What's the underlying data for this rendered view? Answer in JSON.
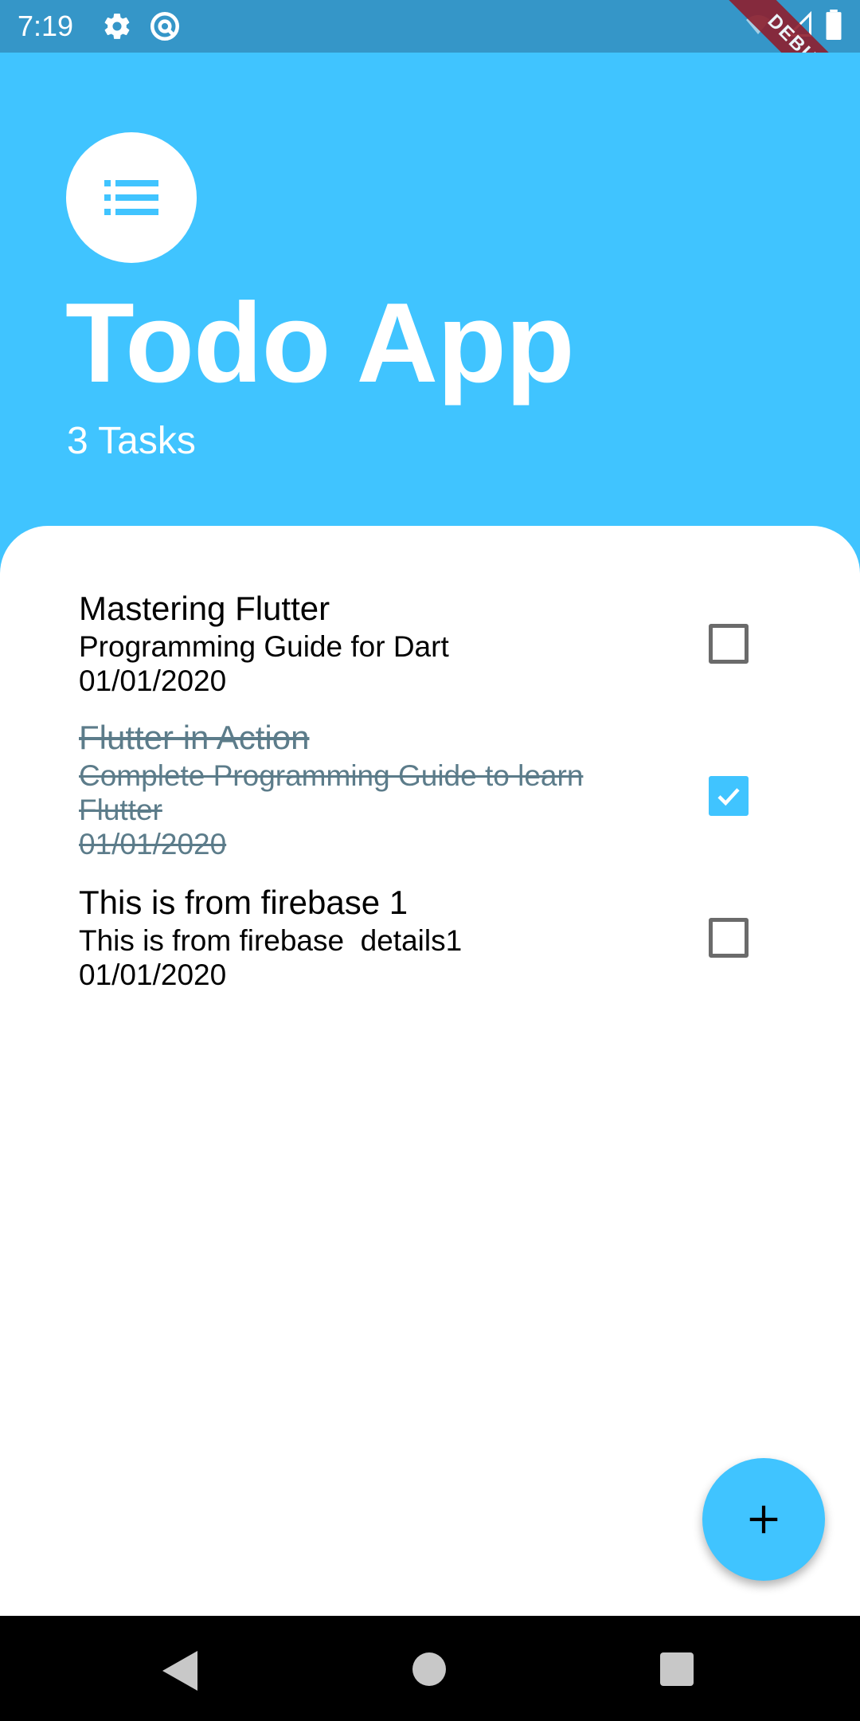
{
  "status_bar": {
    "time": "7:19",
    "debug_label": "DEBUG"
  },
  "header": {
    "title": "Todo App",
    "task_count": "3 Tasks",
    "logo_icon": "list-icon"
  },
  "todos": [
    {
      "title": "Mastering Flutter",
      "detail": "Programming Guide for Dart",
      "date": "01/01/2020",
      "done": false
    },
    {
      "title": "Flutter in Action",
      "detail": "Complete Programming Guide to learn Flutter",
      "date": "01/01/2020",
      "done": true
    },
    {
      "title": "This is from firebase 1",
      "detail": "This is from firebase  details1",
      "date": "01/01/2020",
      "done": false
    }
  ],
  "fab": {
    "icon": "plus-icon"
  },
  "colors": {
    "accent": "#40C4FF",
    "status_bar": "#3596C8",
    "done_text": "#5C7C8A"
  }
}
